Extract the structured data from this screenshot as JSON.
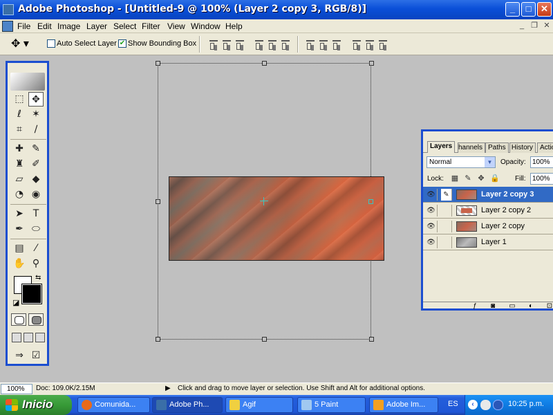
{
  "window": {
    "title": "Adobe Photoshop - [Untitled-9 @ 100% (Layer 2 copy 3, RGB/8)]",
    "controls": {
      "minimize": "_",
      "maximize": "□",
      "close": "✕"
    }
  },
  "menu": {
    "items": [
      "File",
      "Edit",
      "Image",
      "Layer",
      "Select",
      "Filter",
      "View",
      "Window",
      "Help"
    ],
    "mdi_controls": {
      "minimize": "_",
      "restore": "❐",
      "close": "✕"
    }
  },
  "options": {
    "auto_select_label": "Auto Select Layer",
    "auto_select_checked": false,
    "show_bounding_box_label": "Show Bounding Box",
    "show_bounding_box_checked": true,
    "tool_preset_icon": "move-tool-icon"
  },
  "toolbox": {
    "foreground_color": "#ffffff",
    "background_color": "#000000"
  },
  "layers_panel": {
    "tabs": [
      "Layers",
      "Channels",
      "Paths",
      "History",
      "Actions"
    ],
    "active_tab": "Layers",
    "blend_mode": "Normal",
    "opacity_label": "Opacity:",
    "opacity": "100%",
    "lock_label": "Lock:",
    "fill_label": "Fill:",
    "fill": "100%",
    "layers": [
      {
        "name": "Layer 2 copy 3",
        "visible": true,
        "selected": true
      },
      {
        "name": "Layer 2 copy 2",
        "visible": true,
        "selected": false
      },
      {
        "name": "Layer 2 copy",
        "visible": true,
        "selected": false
      },
      {
        "name": "Layer 1",
        "visible": true,
        "selected": false
      }
    ]
  },
  "status": {
    "zoom": "100%",
    "doc_info": "Doc: 109.0K/2.15M",
    "message": "Click and drag to move layer or selection.  Use Shift and Alt for additional options."
  },
  "taskbar": {
    "start_label": "Inicio",
    "tasks": [
      {
        "label": "Comunida...",
        "icon_color": "#e86a1c"
      },
      {
        "label": "Adobe Ph...",
        "icon_color": "#3a6ea8"
      },
      {
        "label": "Agif",
        "icon_color": "#f0d040"
      },
      {
        "label": "5 Paint",
        "icon_color": "#a0c8f0"
      },
      {
        "label": "Adobe Im...",
        "icon_color": "#f2a020"
      }
    ],
    "active_task": 1,
    "language": "ES",
    "clock": "10:25 p.m."
  }
}
